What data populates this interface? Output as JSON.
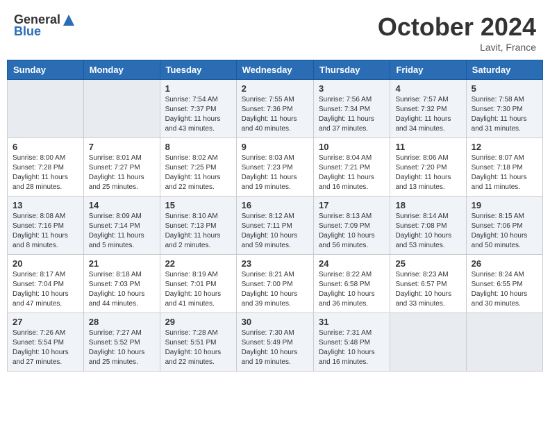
{
  "logo": {
    "general": "General",
    "blue": "Blue"
  },
  "title": "October 2024",
  "location": "Lavit, France",
  "days_header": [
    "Sunday",
    "Monday",
    "Tuesday",
    "Wednesday",
    "Thursday",
    "Friday",
    "Saturday"
  ],
  "weeks": [
    [
      {
        "day": "",
        "info": ""
      },
      {
        "day": "",
        "info": ""
      },
      {
        "day": "1",
        "info": "Sunrise: 7:54 AM\nSunset: 7:37 PM\nDaylight: 11 hours and 43 minutes."
      },
      {
        "day": "2",
        "info": "Sunrise: 7:55 AM\nSunset: 7:36 PM\nDaylight: 11 hours and 40 minutes."
      },
      {
        "day": "3",
        "info": "Sunrise: 7:56 AM\nSunset: 7:34 PM\nDaylight: 11 hours and 37 minutes."
      },
      {
        "day": "4",
        "info": "Sunrise: 7:57 AM\nSunset: 7:32 PM\nDaylight: 11 hours and 34 minutes."
      },
      {
        "day": "5",
        "info": "Sunrise: 7:58 AM\nSunset: 7:30 PM\nDaylight: 11 hours and 31 minutes."
      }
    ],
    [
      {
        "day": "6",
        "info": "Sunrise: 8:00 AM\nSunset: 7:28 PM\nDaylight: 11 hours and 28 minutes."
      },
      {
        "day": "7",
        "info": "Sunrise: 8:01 AM\nSunset: 7:27 PM\nDaylight: 11 hours and 25 minutes."
      },
      {
        "day": "8",
        "info": "Sunrise: 8:02 AM\nSunset: 7:25 PM\nDaylight: 11 hours and 22 minutes."
      },
      {
        "day": "9",
        "info": "Sunrise: 8:03 AM\nSunset: 7:23 PM\nDaylight: 11 hours and 19 minutes."
      },
      {
        "day": "10",
        "info": "Sunrise: 8:04 AM\nSunset: 7:21 PM\nDaylight: 11 hours and 16 minutes."
      },
      {
        "day": "11",
        "info": "Sunrise: 8:06 AM\nSunset: 7:20 PM\nDaylight: 11 hours and 13 minutes."
      },
      {
        "day": "12",
        "info": "Sunrise: 8:07 AM\nSunset: 7:18 PM\nDaylight: 11 hours and 11 minutes."
      }
    ],
    [
      {
        "day": "13",
        "info": "Sunrise: 8:08 AM\nSunset: 7:16 PM\nDaylight: 11 hours and 8 minutes."
      },
      {
        "day": "14",
        "info": "Sunrise: 8:09 AM\nSunset: 7:14 PM\nDaylight: 11 hours and 5 minutes."
      },
      {
        "day": "15",
        "info": "Sunrise: 8:10 AM\nSunset: 7:13 PM\nDaylight: 11 hours and 2 minutes."
      },
      {
        "day": "16",
        "info": "Sunrise: 8:12 AM\nSunset: 7:11 PM\nDaylight: 10 hours and 59 minutes."
      },
      {
        "day": "17",
        "info": "Sunrise: 8:13 AM\nSunset: 7:09 PM\nDaylight: 10 hours and 56 minutes."
      },
      {
        "day": "18",
        "info": "Sunrise: 8:14 AM\nSunset: 7:08 PM\nDaylight: 10 hours and 53 minutes."
      },
      {
        "day": "19",
        "info": "Sunrise: 8:15 AM\nSunset: 7:06 PM\nDaylight: 10 hours and 50 minutes."
      }
    ],
    [
      {
        "day": "20",
        "info": "Sunrise: 8:17 AM\nSunset: 7:04 PM\nDaylight: 10 hours and 47 minutes."
      },
      {
        "day": "21",
        "info": "Sunrise: 8:18 AM\nSunset: 7:03 PM\nDaylight: 10 hours and 44 minutes."
      },
      {
        "day": "22",
        "info": "Sunrise: 8:19 AM\nSunset: 7:01 PM\nDaylight: 10 hours and 41 minutes."
      },
      {
        "day": "23",
        "info": "Sunrise: 8:21 AM\nSunset: 7:00 PM\nDaylight: 10 hours and 39 minutes."
      },
      {
        "day": "24",
        "info": "Sunrise: 8:22 AM\nSunset: 6:58 PM\nDaylight: 10 hours and 36 minutes."
      },
      {
        "day": "25",
        "info": "Sunrise: 8:23 AM\nSunset: 6:57 PM\nDaylight: 10 hours and 33 minutes."
      },
      {
        "day": "26",
        "info": "Sunrise: 8:24 AM\nSunset: 6:55 PM\nDaylight: 10 hours and 30 minutes."
      }
    ],
    [
      {
        "day": "27",
        "info": "Sunrise: 7:26 AM\nSunset: 5:54 PM\nDaylight: 10 hours and 27 minutes."
      },
      {
        "day": "28",
        "info": "Sunrise: 7:27 AM\nSunset: 5:52 PM\nDaylight: 10 hours and 25 minutes."
      },
      {
        "day": "29",
        "info": "Sunrise: 7:28 AM\nSunset: 5:51 PM\nDaylight: 10 hours and 22 minutes."
      },
      {
        "day": "30",
        "info": "Sunrise: 7:30 AM\nSunset: 5:49 PM\nDaylight: 10 hours and 19 minutes."
      },
      {
        "day": "31",
        "info": "Sunrise: 7:31 AM\nSunset: 5:48 PM\nDaylight: 10 hours and 16 minutes."
      },
      {
        "day": "",
        "info": ""
      },
      {
        "day": "",
        "info": ""
      }
    ]
  ]
}
